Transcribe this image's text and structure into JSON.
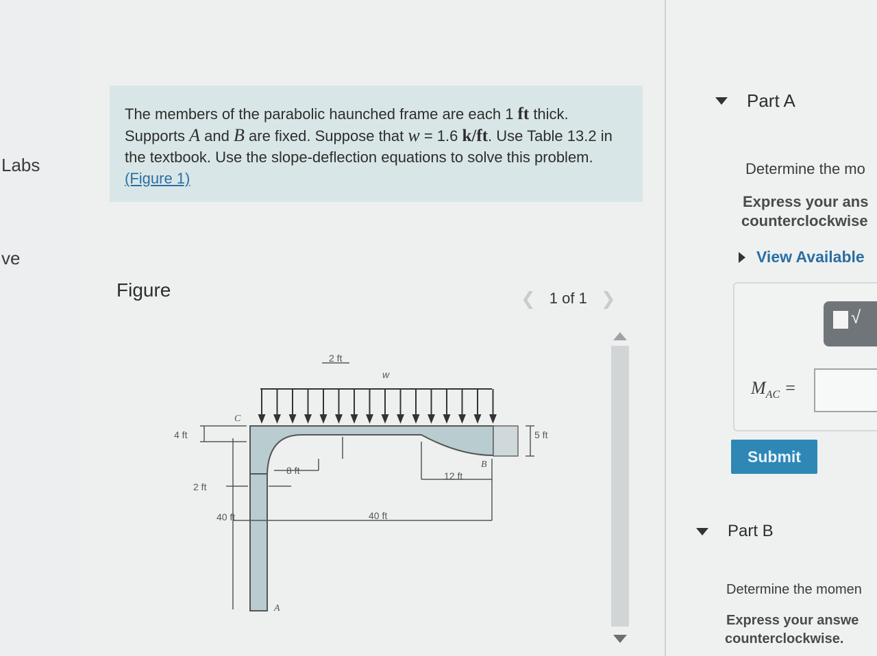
{
  "left_nav": {
    "items": [
      {
        "label": "Labs"
      },
      {
        "label": "ve"
      }
    ]
  },
  "problem": {
    "text_1": "The members of the parabolic haunched frame are each 1 ",
    "unit_ft": "ft",
    "text_2": " thick. Supports ",
    "var_a": "A",
    "text_3": " and ",
    "var_b": "B",
    "text_4": " are fixed. Suppose that ",
    "var_w": "w",
    "text_5": " = 1.6 ",
    "unit_kft": "k/ft",
    "text_6": ". Use Table 13.2 in the textbook. Use the slope-deflection equations to solve this problem. ",
    "figure_link": "(Figure 1)"
  },
  "figure": {
    "title": "Figure",
    "pager": "1 of 1",
    "labels": {
      "top_width": "2 ft",
      "load": "w",
      "c": "C",
      "left_haunch": "4 ft",
      "right_haunch": "5 ft",
      "haunch_left_len": "8 ft",
      "haunch_right_len": "12 ft",
      "b": "B",
      "col_width": "2 ft",
      "height": "40 ft",
      "span": "40 ft",
      "a": "A"
    }
  },
  "part_a": {
    "title": "Part A",
    "prompt": "Determine the mo",
    "express": "Express your ans",
    "express_2": "counterclockwise",
    "view_available": "View Available",
    "answer_label": "M",
    "answer_sub": "AC",
    "answer_eq": " =",
    "answer_value": "",
    "submit": "Submit"
  },
  "part_b": {
    "title": "Part B",
    "prompt": "Determine the momen",
    "express": "Express your answe",
    "express_2": "counterclockwise."
  },
  "colors": {
    "intro_bg": "#d9e6e7",
    "link": "#2b6ea3",
    "submit_bg": "#2f87b6",
    "frame_fill": "#b9cccf"
  }
}
